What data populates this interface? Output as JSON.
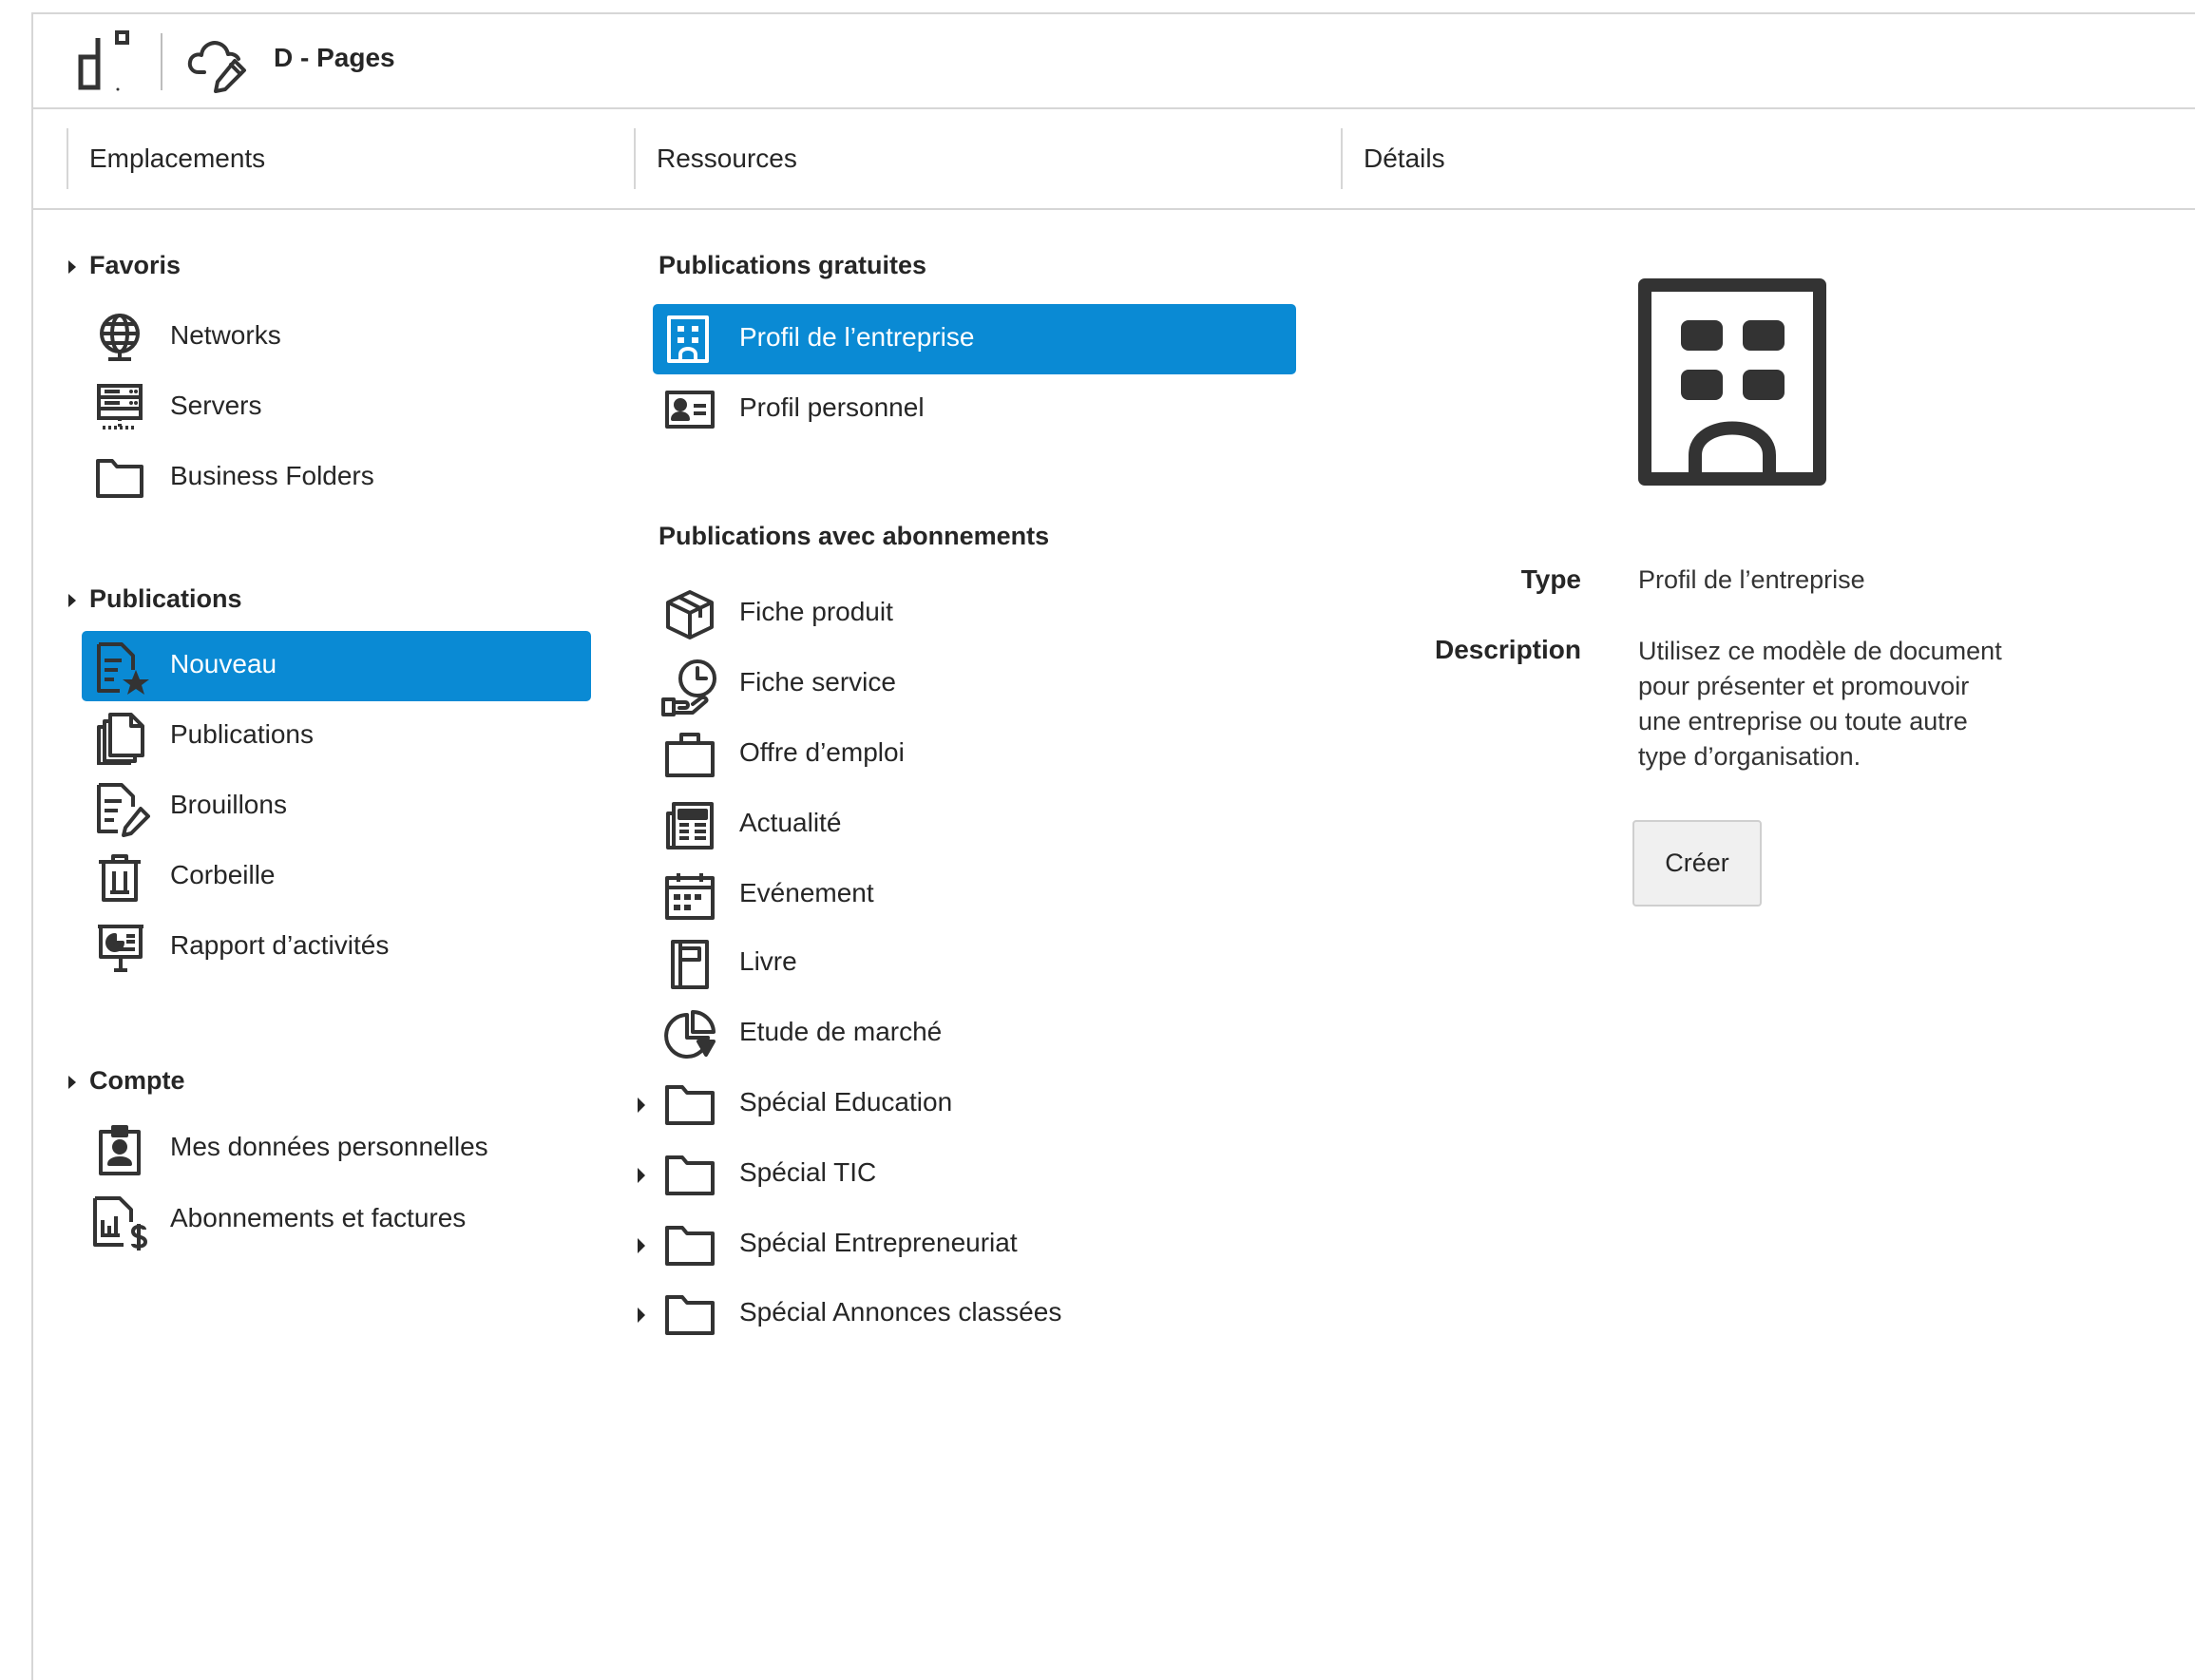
{
  "app": {
    "title": "D - Pages"
  },
  "columns": {
    "locations": "Emplacements",
    "resources": "Ressources",
    "details": "Détails"
  },
  "left": {
    "favorites": {
      "title": "Favoris",
      "items": [
        {
          "label": "Networks",
          "icon": "globe-icon"
        },
        {
          "label": "Servers",
          "icon": "server-icon"
        },
        {
          "label": "Business Folders",
          "icon": "folder-icon"
        }
      ]
    },
    "publications": {
      "title": "Publications",
      "items": [
        {
          "label": "Nouveau",
          "icon": "new-document-star-icon",
          "selected": true
        },
        {
          "label": "Publications",
          "icon": "documents-stack-icon"
        },
        {
          "label": "Brouillons",
          "icon": "document-edit-icon"
        },
        {
          "label": "Corbeille",
          "icon": "trash-icon"
        },
        {
          "label": "Rapport d’activités",
          "icon": "presentation-chart-icon"
        }
      ]
    },
    "account": {
      "title": "Compte",
      "items": [
        {
          "label": "Mes données personnelles",
          "icon": "badge-person-icon"
        },
        {
          "label": "Abonnements et factures",
          "icon": "invoice-dollar-icon"
        }
      ]
    }
  },
  "middle": {
    "free": {
      "title": "Publications gratuites",
      "items": [
        {
          "label": "Profil de l’entreprise",
          "icon": "building-icon",
          "selected": true
        },
        {
          "label": "Profil personnel",
          "icon": "contact-card-icon"
        }
      ]
    },
    "subscriptions": {
      "title": "Publications avec abonnements",
      "items": [
        {
          "label": "Fiche produit",
          "icon": "box-icon"
        },
        {
          "label": "Fiche service",
          "icon": "clock-hand-icon"
        },
        {
          "label": "Offre d’emploi",
          "icon": "briefcase-icon"
        },
        {
          "label": "Actualité",
          "icon": "newspaper-icon"
        },
        {
          "label": "Evénement",
          "icon": "calendar-icon"
        },
        {
          "label": "Livre",
          "icon": "book-icon"
        },
        {
          "label": "Etude de marché",
          "icon": "pie-chart-icon"
        },
        {
          "label": "Spécial Education",
          "icon": "folder-icon",
          "expandable": true
        },
        {
          "label": "Spécial TIC",
          "icon": "folder-icon",
          "expandable": true
        },
        {
          "label": "Spécial Entrepreneuriat",
          "icon": "folder-icon",
          "expandable": true
        },
        {
          "label": "Spécial Annonces classées",
          "icon": "folder-icon",
          "expandable": true
        }
      ]
    }
  },
  "details": {
    "type_label": "Type",
    "type_value": "Profil de l’entreprise",
    "description_label": "Description",
    "description_lines": [
      "Utilisez ce modèle de document",
      "pour présenter et promouvoir",
      "une entreprise ou toute autre",
      "type d’organisation."
    ],
    "create_label": "Créer"
  },
  "colors": {
    "accent": "#0a8ad4",
    "text": "#262626",
    "border": "#d6d6d6"
  }
}
